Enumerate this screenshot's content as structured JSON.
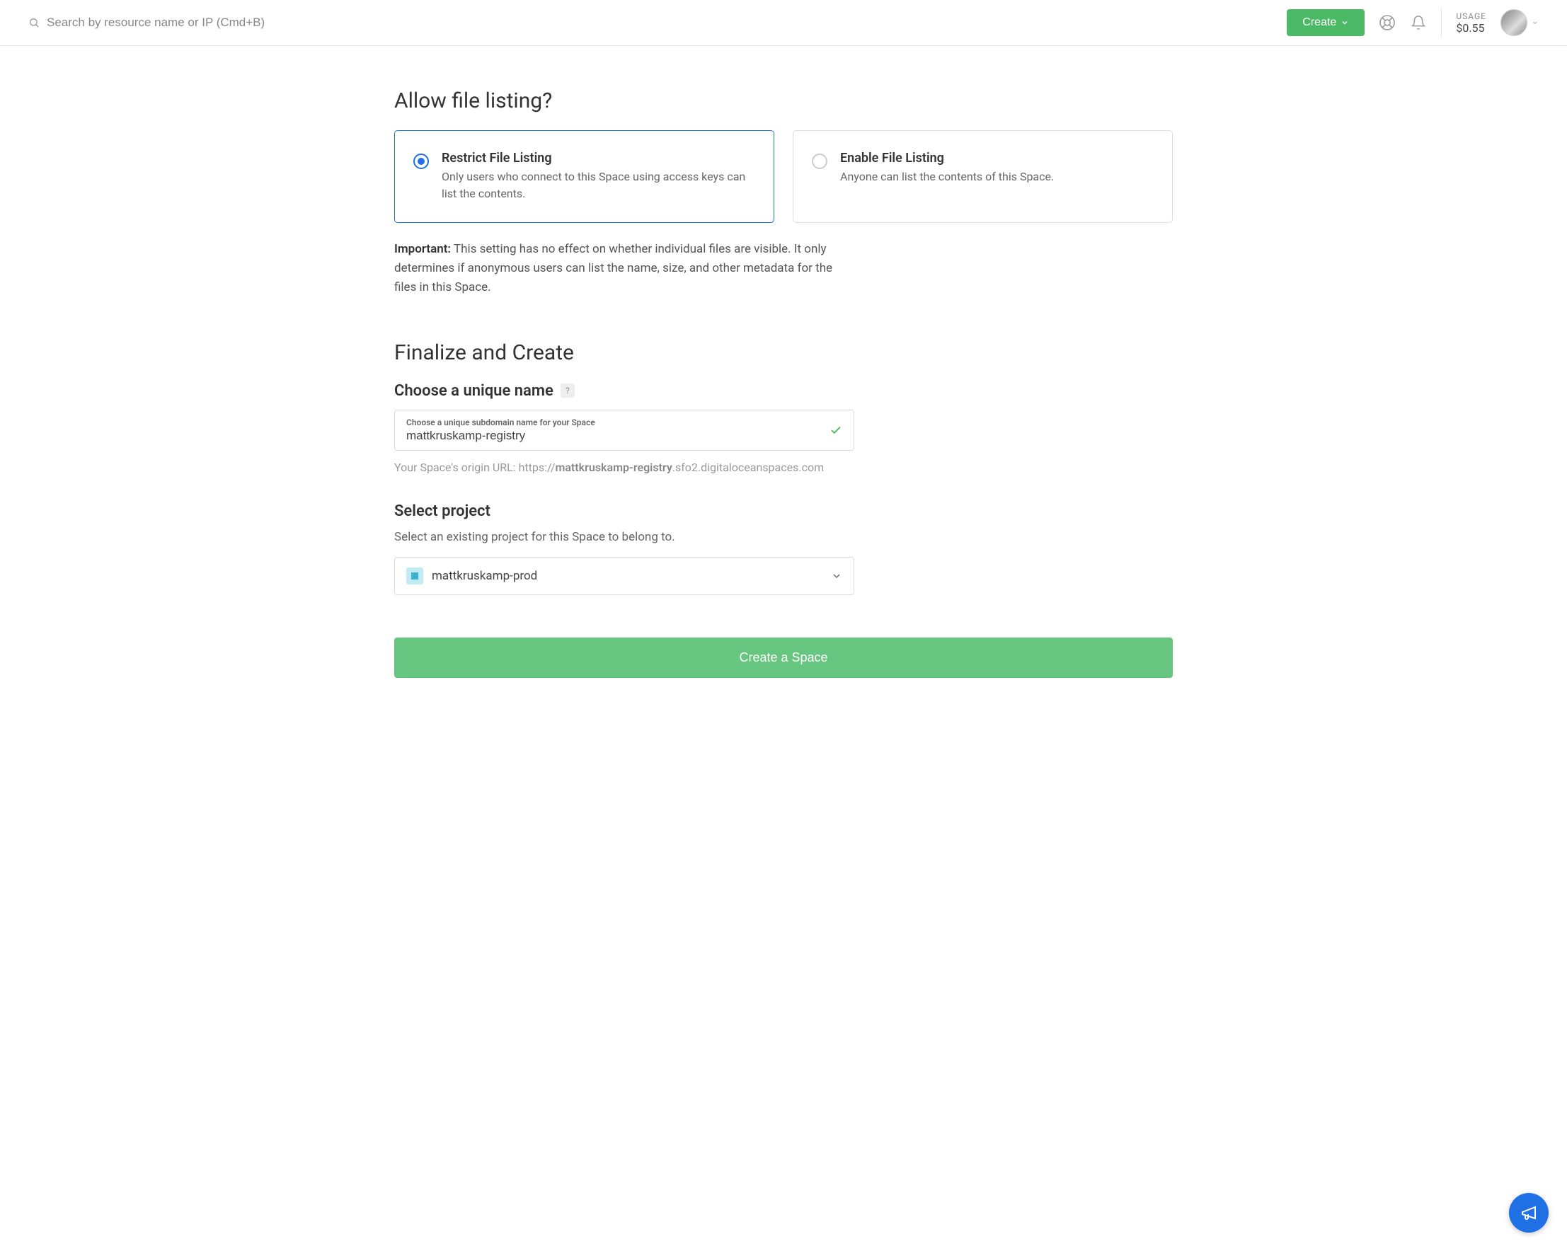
{
  "header": {
    "search_placeholder": "Search by resource name or IP (Cmd+B)",
    "create_label": "Create",
    "usage_label": "USAGE",
    "usage_value": "$0.55"
  },
  "file_listing": {
    "title": "Allow file listing?",
    "restrict": {
      "title": "Restrict File Listing",
      "desc": "Only users who connect to this Space using access keys can list the contents."
    },
    "enable": {
      "title": "Enable File Listing",
      "desc": "Anyone can list the contents of this Space."
    },
    "important_label": "Important:",
    "important_text": " This setting has no effect on whether individual files are visible. It only determines if anonymous users can list the name, size, and other metadata for the files in this Space."
  },
  "finalize": {
    "title": "Finalize and Create",
    "name_section_title": "Choose a unique name",
    "name_hint": "?",
    "name_small_label": "Choose a unique subdomain name for your Space",
    "name_value": "mattkruskamp-registry",
    "origin_prefix": "Your Space's origin URL: https://",
    "origin_bold": "mattkruskamp-registry",
    "origin_suffix": ".sfo2.digitaloceanspaces.com",
    "project_section_title": "Select project",
    "project_desc": "Select an existing project for this Space to belong to.",
    "project_selected": "mattkruskamp-prod",
    "submit_label": "Create a Space"
  }
}
